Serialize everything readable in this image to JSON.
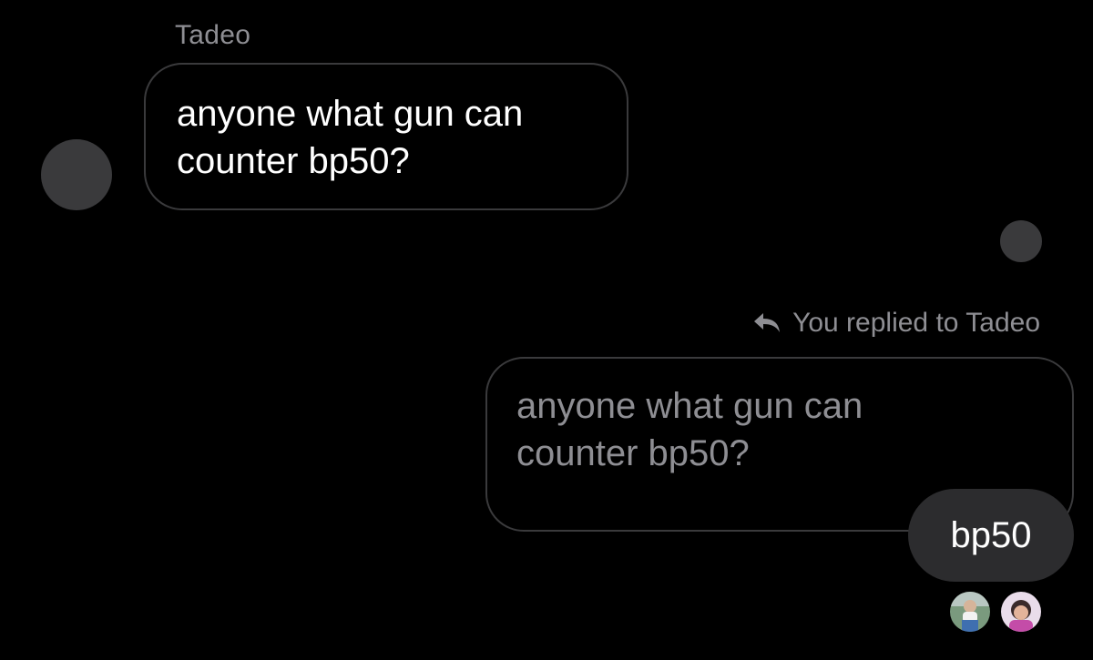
{
  "thread": {
    "incoming": {
      "sender_name": "Tadeo",
      "line1": "anyone what gun can",
      "line2": "counter bp50?"
    },
    "reply": {
      "header_text": "You replied to Tadeo",
      "quoted_line1": "anyone what gun can",
      "quoted_line2": "counter bp50?",
      "message_text": "bp50"
    },
    "seen_by": [
      {
        "name": "seen-avatar-1"
      },
      {
        "name": "seen-avatar-2"
      }
    ]
  },
  "colors": {
    "background": "#000000",
    "bubble_border": "#3a3a3c",
    "outgoing_bubble": "#2c2c2e",
    "secondary_text": "#8e8e93"
  },
  "icons": {
    "reply": "reply-arrow-icon"
  }
}
